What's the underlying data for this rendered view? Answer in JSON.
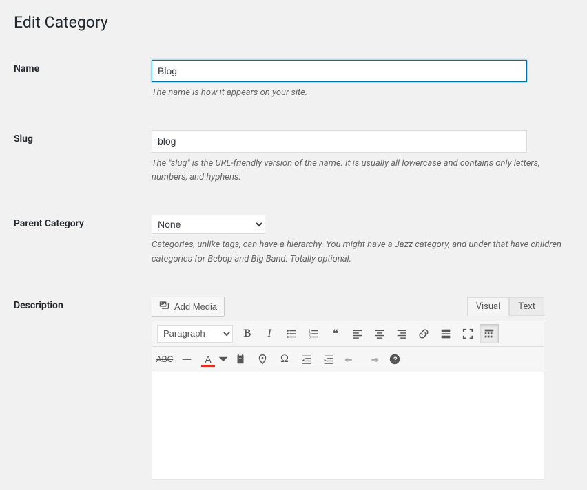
{
  "page_title": "Edit Category",
  "fields": {
    "name": {
      "label": "Name",
      "value": "Blog",
      "help": "The name is how it appears on your site."
    },
    "slug": {
      "label": "Slug",
      "value": "blog",
      "help": "The \"slug\" is the URL-friendly version of the name. It is usually all lowercase and contains only letters, numbers, and hyphens."
    },
    "parent": {
      "label": "Parent Category",
      "selected": "None",
      "help": "Categories, unlike tags, can have a hierarchy. You might have a Jazz category, and under that have children categories for Bebop and Big Band. Totally optional."
    },
    "description": {
      "label": "Description"
    }
  },
  "editor": {
    "add_media": "Add Media",
    "tabs": {
      "visual": "Visual",
      "text": "Text"
    },
    "format_selector": "Paragraph"
  }
}
